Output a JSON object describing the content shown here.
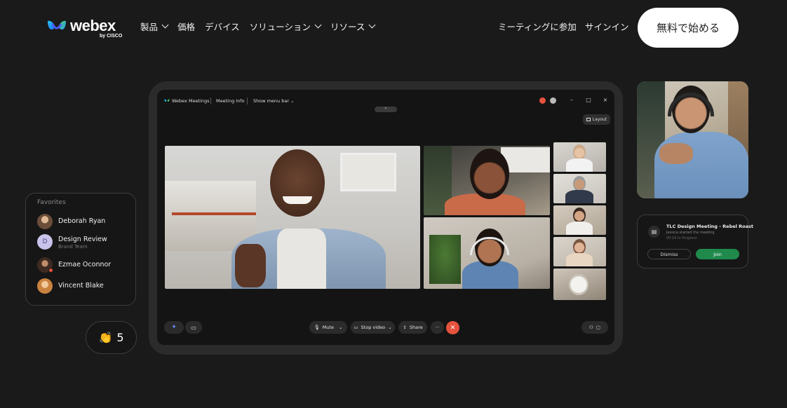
{
  "header": {
    "logo_word": "webex",
    "logo_sub": "by CISCO",
    "nav": [
      {
        "label": "製品",
        "has_menu": true
      },
      {
        "label": "価格",
        "has_menu": false
      },
      {
        "label": "デバイス",
        "has_menu": false
      },
      {
        "label": "ソリューション",
        "has_menu": true
      },
      {
        "label": "リソース",
        "has_menu": true
      }
    ],
    "join_meeting": "ミーティングに参加",
    "sign_in": "サインイン",
    "cta": "無料で始める"
  },
  "meeting_app": {
    "app_title": "Webex Meetings",
    "meeting_info": "Meeting Info",
    "show_menu_bar": "Show menu bar",
    "layout_button": "Layout",
    "controls": {
      "mute": "Mute",
      "stop_video": "Stop video",
      "share": "Share",
      "more": "···"
    }
  },
  "favorites": {
    "title": "Favorites",
    "items": [
      {
        "name": "Deborah Ryan",
        "sub": "",
        "avatar_color": "#8a6a54"
      },
      {
        "name": "Design Review",
        "sub": "Brand Team",
        "avatar_initial": "D",
        "avatar_color": "#c8c3ea"
      },
      {
        "name": "Ezmae Oconnor",
        "sub": "",
        "avatar_color": "#6a4a3a"
      },
      {
        "name": "Vincent Blake",
        "sub": "",
        "avatar_color": "#d9a06a"
      }
    ]
  },
  "reaction": {
    "emoji": "👏",
    "count": "5"
  },
  "notification": {
    "title": "TLC Design Meeting - Rebel Roast",
    "subtitle": "Jessica started the meeting",
    "time": "00:16 In Progress",
    "dismiss": "Dismiss",
    "join": "Join"
  },
  "colors": {
    "background": "#1a1a1a",
    "end_call": "#e5533d",
    "join_green": "#1f8a4c"
  }
}
